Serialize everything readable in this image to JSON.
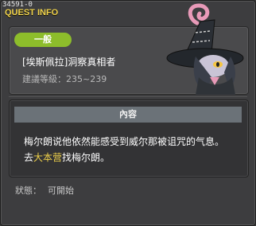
{
  "window": {
    "quest_id": "34591-0",
    "title": "QUEST INFO"
  },
  "quest": {
    "category": "一般",
    "name": "[埃斯佩拉]洞察真相者",
    "level_label": "建議等級：",
    "level_range": "235~239"
  },
  "content": {
    "header": "內容",
    "line1": "梅尔朗说他依然能感受到威尔那被诅咒的气息。",
    "line2_prefix": "去",
    "line2_location": "大本营",
    "line2_suffix": "找梅尔朗。"
  },
  "status": {
    "label": "狀態：",
    "value": "可開始"
  },
  "npc": {
    "icon": "witch-npc-portrait"
  },
  "colors": {
    "accent": "#f0d24a",
    "badge": "#8dbd2b"
  }
}
